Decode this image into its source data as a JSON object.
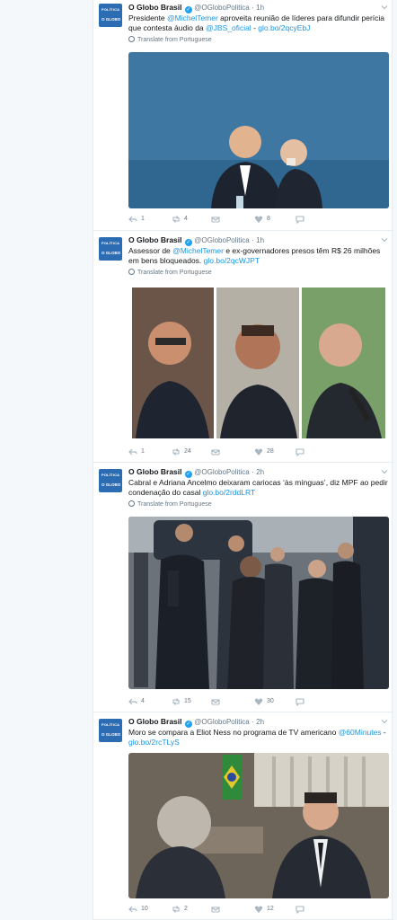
{
  "tweets": [
    {
      "avatar_top": "POLÍTICA",
      "avatar_bottom": "O GLOBO",
      "name": "O Globo Brasil",
      "handle": "@OGloboPolitica",
      "dot": "·",
      "time": "1h",
      "text_parts": [
        "Presidente ",
        "@MichelTemer",
        " aproveita reunião de líderes para difundir perícia que contesta áudio da ",
        "@JBS_oficial",
        " - ",
        "glo.bo/2qcyEbJ"
      ],
      "translate": "Translate from Portuguese",
      "replies": "1",
      "retweets": "4",
      "likes": "8"
    },
    {
      "avatar_top": "POLÍTICA",
      "avatar_bottom": "O GLOBO",
      "name": "O Globo Brasil",
      "handle": "@OGloboPolitica",
      "dot": "·",
      "time": "1h",
      "text_parts": [
        "Assessor de ",
        "@MichelTemer",
        " e ex-governadores presos têm R$ 26 milhões em bens bloqueados. ",
        "glo.bo/2qcWJPT"
      ],
      "translate": "Translate from Portuguese",
      "replies": "1",
      "retweets": "24",
      "likes": "28"
    },
    {
      "avatar_top": "POLÍTICA",
      "avatar_bottom": "O GLOBO",
      "name": "O Globo Brasil",
      "handle": "@OGloboPolitica",
      "dot": "·",
      "time": "2h",
      "text_parts": [
        "Cabral e Adriana Ancelmo deixaram cariocas ‘às mínguas’, diz MPF ao pedir condenação do casal ",
        "glo.bo/2rddLRT"
      ],
      "translate": "Translate from Portuguese",
      "replies": "4",
      "retweets": "15",
      "likes": "30"
    },
    {
      "avatar_top": "POLÍTICA",
      "avatar_bottom": "O GLOBO",
      "name": "O Globo Brasil",
      "handle": "@OGloboPolitica",
      "dot": "·",
      "time": "2h",
      "text_parts": [
        "Moro se compara a Eliot Ness no programa de TV americano ",
        "@60Minutes",
        " - ",
        "glo.bo/2rcTLyS"
      ],
      "replies": "10",
      "retweets": "2",
      "likes": "12"
    }
  ],
  "colors": {
    "accent": "#1da1f2",
    "link": "#1b95e0",
    "muted": "#657786",
    "avatar": "#2b6cb3"
  },
  "icons": [
    "reply-icon",
    "retweet-icon",
    "like-icon",
    "dm-icon",
    "chevron-down-icon",
    "verified-icon",
    "globe-icon"
  ]
}
